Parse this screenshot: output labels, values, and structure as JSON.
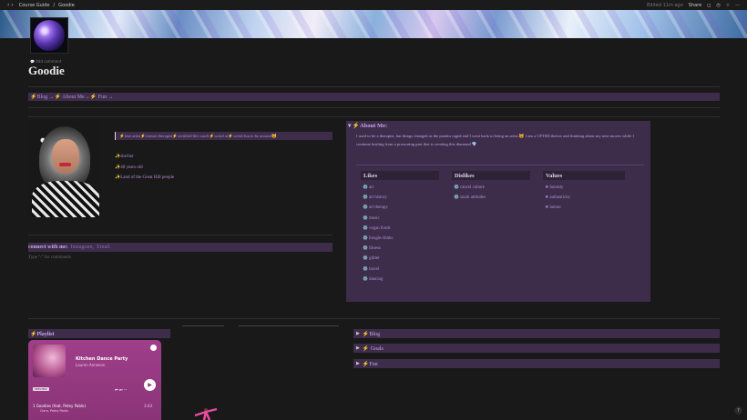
{
  "topbar": {
    "nav_arrows": "‹ ›",
    "crumb_1": "Course Guide",
    "crumb_2": "Goodie",
    "edited": "Edited 11m ago",
    "share": "Share"
  },
  "page": {
    "add_comment": "Add comment",
    "title": "Goodie"
  },
  "nav_links": {
    "blog": "⚡Blog",
    "about": "⚡ About Me",
    "fun": "⚡ Fun"
  },
  "intro_quote": "⚡fine artist⚡former therapist⚡certified life coach⚡weird af⚡weird fun to be around😺",
  "facts": [
    "✨she/her",
    "✨40 years old",
    "✨Land of the Great Hill people"
  ],
  "connect": {
    "label": "connect with me:",
    "instagram": "Instagram,",
    "email": "Email."
  },
  "type_hint": "Type \"/\" for commands",
  "about": {
    "heading": "⚡About Me:",
    "description": "I used to be a therapist, but things changed as the pandor raged and I went back to being an artist.😺 I am a CPTSD thriver and thinking about my next moves while I continue healing from a pressuring past that is creating this diamond 💎",
    "likes_header": "Likes",
    "likes": [
      "⚙️ art",
      "⚙️ art history",
      "⚙️ art therapy",
      "⚙️ music",
      "⚙️ vegan foods",
      "⚙️ boogie drinks",
      "⚙️ fitness",
      "⚙️ glitter",
      "⚙️ travel",
      "⚙️ dancing"
    ],
    "dislikes_header": "Dislikes",
    "dislikes": [
      "⚙️ cancel culture",
      "⚙️ snark attitudes"
    ],
    "values_header": "Values",
    "values": [
      "★ honesty",
      "★ authenticity",
      "★ humor"
    ]
  },
  "toggles": {
    "blog": "⚡Blog",
    "goals": "⚡ Goals",
    "fun": "⚡Fun"
  },
  "playlist": {
    "heading": "⚡Playlist",
    "song": "Kitchen Dance Party",
    "artist": "Lauren Anneson",
    "badge": "PREVIEW",
    "controls": "⏮ ⏭ ···",
    "track": "1   Goodies (feat. Petey Pablo)",
    "track_artist": "Ciara, Petey Pablo",
    "duration": "3:43"
  },
  "help": "?"
}
